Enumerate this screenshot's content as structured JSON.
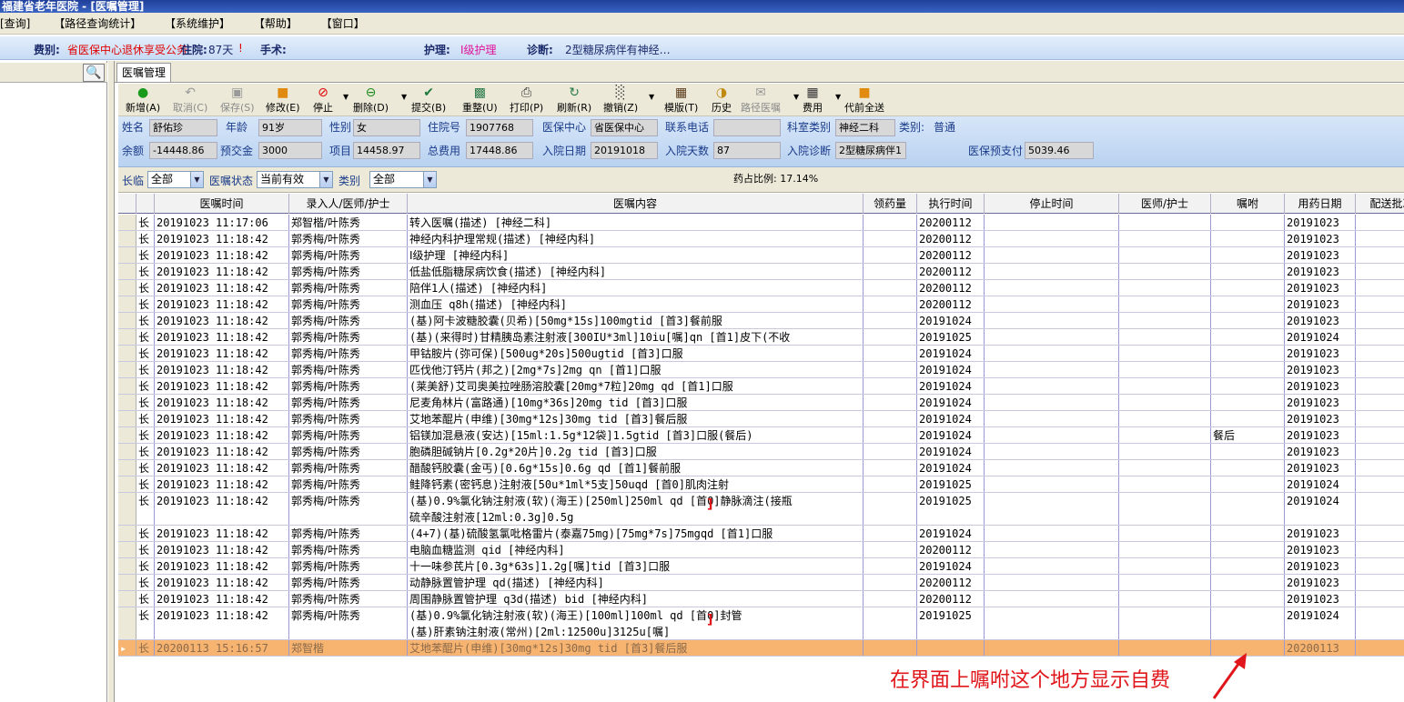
{
  "window": {
    "title": "福建省老年医院 - [医嘱管理]"
  },
  "menu": [
    "[查询]",
    "【路径查询统计】",
    "【系统维护】",
    "【帮助】",
    "【窗口】"
  ],
  "infobar": {
    "fee_label": "费别:",
    "fee_value": "省医保中心退休享受公务",
    "stay_label": "住院:",
    "stay_value": "87天",
    "stay_mark": "!",
    "surgery_label": "手术:",
    "surgery_value": "",
    "nursing_label": "护理:",
    "nursing_value": "Ⅰ级护理",
    "diagnosis_label": "诊断:",
    "diagnosis_value": "2型糖尿病伴有神经…"
  },
  "tab": {
    "label": "医嘱管理"
  },
  "toolbar": {
    "new": "新增(A)",
    "cancel": "取消(C)",
    "save": "保存(S)",
    "edit": "修改(E)",
    "stop": "停止",
    "delete": "删除(D)",
    "submit": "提交(B)",
    "reorg": "重整(U)",
    "print": "打印(P)",
    "refresh": "刷新(R)",
    "revoke": "撤销(Z)",
    "template": "模版(T)",
    "history": "历史",
    "path": "路径医嘱",
    "fee": "费用",
    "sendall": "代前全送"
  },
  "patient": {
    "name_label": "姓名",
    "name": "舒佑珍",
    "age_label": "年龄",
    "age": "91岁",
    "sex_label": "性别",
    "sex": "女",
    "inpatient_no_label": "住院号",
    "inpatient_no": "1907768",
    "insurance_label": "医保中心",
    "insurance": "省医保中心",
    "phone_label": "联系电话",
    "phone": "",
    "dept_label": "科室类别",
    "dept": "神经二科",
    "category_label": "类别:",
    "category": "普通",
    "balance_label": "余额",
    "balance": "-14448.86",
    "deposit_label": "预交金",
    "deposit": "3000",
    "items_label": "项目",
    "items": "14458.97",
    "total_label": "总费用",
    "total": "17448.86",
    "admit_date_label": "入院日期",
    "admit_date": "20191018",
    "days_label": "入院天数",
    "days": "87",
    "admit_diag_label": "入院诊断",
    "admit_diag": "2型糖尿病伴1",
    "prepay_label": "医保预支付",
    "prepay": "5039.46"
  },
  "filter": {
    "long_label": "长临",
    "long_value": "全部",
    "status_label": "医嘱状态",
    "status_value": "当前有效",
    "type_label": "类别",
    "type_value": "全部",
    "ratio": "药占比例: 17.14%"
  },
  "columns": [
    "医嘱时间",
    "录入人/医师/护士",
    "医嘱内容",
    "领药量",
    "执行时间",
    "停止时间",
    "医师/护士",
    "嘱咐",
    "用药日期",
    "配送批次"
  ],
  "rows": [
    {
      "t": "长",
      "time": "20191023 11:17:06",
      "who": "郑智楷/叶陈秀",
      "content": "转入医嘱(描述)    [神经二科]",
      "exec": "20200112",
      "note": "",
      "date": "20191023"
    },
    {
      "t": "长",
      "time": "20191023 11:18:42",
      "who": "郭秀梅/叶陈秀",
      "content": "神经内科护理常规(描述)    [神经内科]",
      "exec": "20200112",
      "note": "",
      "date": "20191023"
    },
    {
      "t": "长",
      "time": "20191023 11:18:42",
      "who": "郭秀梅/叶陈秀",
      "content": "Ⅰ级护理    [神经内科]",
      "exec": "20200112",
      "note": "",
      "date": "20191023"
    },
    {
      "t": "长",
      "time": "20191023 11:18:42",
      "who": "郭秀梅/叶陈秀",
      "content": "低盐低脂糖尿病饮食(描述)    [神经内科]",
      "exec": "20200112",
      "note": "",
      "date": "20191023"
    },
    {
      "t": "长",
      "time": "20191023 11:18:42",
      "who": "郭秀梅/叶陈秀",
      "content": "陪伴1人(描述)    [神经内科]",
      "exec": "20200112",
      "note": "",
      "date": "20191023"
    },
    {
      "t": "长",
      "time": "20191023 11:18:42",
      "who": "郭秀梅/叶陈秀",
      "content": "测血压 q8h(描述)    [神经内科]",
      "exec": "20200112",
      "note": "",
      "date": "20191023"
    },
    {
      "t": "长",
      "time": "20191023 11:18:42",
      "who": "郭秀梅/叶陈秀",
      "content": "(基)阿卡波糖胶囊(贝希)[50mg*15s]100mgtid [首3]餐前服",
      "exec": "20191024",
      "note": "",
      "date": "20191023"
    },
    {
      "t": "长",
      "time": "20191023 11:18:42",
      "who": "郭秀梅/叶陈秀",
      "content": "(基)(来得时)甘精胰岛素注射液[300IU*3ml]10iu[嘱]qn [首1]皮下(不收",
      "exec": "20191025",
      "note": "",
      "date": "20191024"
    },
    {
      "t": "长",
      "time": "20191023 11:18:42",
      "who": "郭秀梅/叶陈秀",
      "content": "甲钴胺片(弥可保)[500ug*20s]500ugtid [首3]口服",
      "exec": "20191024",
      "note": "",
      "date": "20191023"
    },
    {
      "t": "长",
      "time": "20191023 11:18:42",
      "who": "郭秀梅/叶陈秀",
      "content": "匹伐他汀钙片(邦之)[2mg*7s]2mg qn [首1]口服",
      "exec": "20191024",
      "note": "",
      "date": "20191023"
    },
    {
      "t": "长",
      "time": "20191023 11:18:42",
      "who": "郭秀梅/叶陈秀",
      "content": "(莱美舒)艾司奥美拉唑肠溶胶囊[20mg*7粒]20mg qd [首1]口服",
      "exec": "20191024",
      "note": "",
      "date": "20191023"
    },
    {
      "t": "长",
      "time": "20191023 11:18:42",
      "who": "郭秀梅/叶陈秀",
      "content": "尼麦角林片(富路通)[10mg*36s]20mg tid [首3]口服",
      "exec": "20191024",
      "note": "",
      "date": "20191023"
    },
    {
      "t": "长",
      "time": "20191023 11:18:42",
      "who": "郭秀梅/叶陈秀",
      "content": "艾地苯醌片(申维)[30mg*12s]30mg tid [首3]餐后服",
      "exec": "20191024",
      "note": "",
      "date": "20191023"
    },
    {
      "t": "长",
      "time": "20191023 11:18:42",
      "who": "郭秀梅/叶陈秀",
      "content": "铝镁加混悬液(安达)[15ml:1.5g*12袋]1.5gtid [首3]口服(餐后)",
      "exec": "20191024",
      "note": "餐后",
      "date": "20191023"
    },
    {
      "t": "长",
      "time": "20191023 11:18:42",
      "who": "郭秀梅/叶陈秀",
      "content": "胞磷胆碱钠片[0.2g*20片]0.2g tid [首3]口服",
      "exec": "20191024",
      "note": "",
      "date": "20191023"
    },
    {
      "t": "长",
      "time": "20191023 11:18:42",
      "who": "郭秀梅/叶陈秀",
      "content": "醋酸钙胶囊(金丐)[0.6g*15s]0.6g qd [首1]餐前服",
      "exec": "20191024",
      "note": "",
      "date": "20191023"
    },
    {
      "t": "长",
      "time": "20191023 11:18:42",
      "who": "郭秀梅/叶陈秀",
      "content": "鲑降钙素(密钙息)注射液[50u*1ml*5支]50uqd [首0]肌肉注射",
      "exec": "20191025",
      "note": "",
      "date": "20191024"
    },
    {
      "t": "长",
      "time": "20191023 11:18:42",
      "who": "郭秀梅/叶陈秀",
      "content": "(基)0.9%氯化钠注射液(软)(海王)[250ml]250ml qd [首0]静脉滴注(接瓶",
      "content2": "硫辛酸注射液[12ml:0.3g]0.5g",
      "exec": "20191025",
      "note": "",
      "date": "20191024"
    },
    {
      "t": "长",
      "time": "20191023 11:18:42",
      "who": "郭秀梅/叶陈秀",
      "content": "(4+7)(基)硫酸氢氯吡格雷片(泰嘉75mg)[75mg*7s]75mgqd [首1]口服",
      "exec": "20191024",
      "note": "",
      "date": "20191023"
    },
    {
      "t": "长",
      "time": "20191023 11:18:42",
      "who": "郭秀梅/叶陈秀",
      "content": "电脑血糖监测  qid  [神经内科]",
      "exec": "20200112",
      "note": "",
      "date": "20191023"
    },
    {
      "t": "长",
      "time": "20191023 11:18:42",
      "who": "郭秀梅/叶陈秀",
      "content": "十一味参芪片[0.3g*63s]1.2g[嘱]tid [首3]口服",
      "exec": "20191024",
      "note": "",
      "date": "20191023"
    },
    {
      "t": "长",
      "time": "20191023 11:18:42",
      "who": "郭秀梅/叶陈秀",
      "content": "动静脉置管护理 qd(描述)    [神经内科]",
      "exec": "20200112",
      "note": "",
      "date": "20191023"
    },
    {
      "t": "长",
      "time": "20191023 11:18:42",
      "who": "郭秀梅/叶陈秀",
      "content": "周围静脉置管护理 q3d(描述)  bid  [神经内科]",
      "exec": "20200112",
      "note": "",
      "date": "20191023"
    },
    {
      "t": "长",
      "time": "20191023 11:18:42",
      "who": "郭秀梅/叶陈秀",
      "content": "(基)0.9%氯化钠注射液(软)(海王)[100ml]100ml qd [首0]封管",
      "content2": "(基)肝素钠注射液(常州)[2ml:12500u]3125u[嘱]",
      "exec": "20191025",
      "note": "",
      "date": "20191024"
    },
    {
      "t": "长",
      "time": "20200113 15:16:57",
      "who": "郑智楷",
      "content": "艾地苯醌片(申维)[30mg*12s]30mg tid [首3]餐后服",
      "exec": "",
      "note": "",
      "date": "20200113",
      "selected": true
    }
  ],
  "annotation": {
    "text": "在界面上嘱咐这个地方显示自费",
    "color": "#e0161b"
  }
}
